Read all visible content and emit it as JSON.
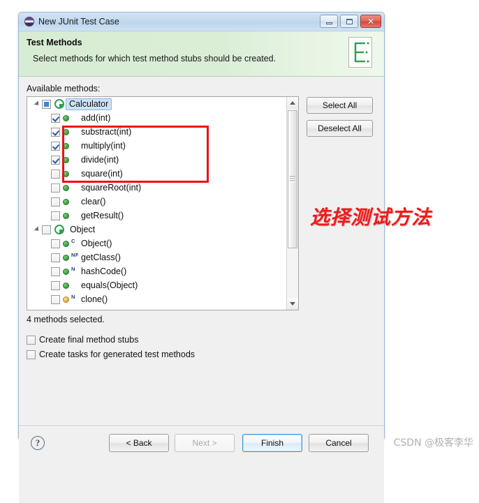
{
  "window": {
    "title": "New JUnit Test Case",
    "icon": "junit-icon",
    "controls": {
      "minimize": "minimize-icon",
      "maximize": "maximize-icon",
      "close": "close-icon"
    }
  },
  "header": {
    "title": "Test Methods",
    "subtitle": "Select methods for which test method stubs should be created.",
    "icon": "junit-banner-icon"
  },
  "main": {
    "available_label": "Available methods:",
    "status": "4 methods selected.",
    "tree": [
      {
        "label": "Calculator",
        "type": "class",
        "level": 0,
        "checkbox": "partial",
        "selected": true,
        "expanded": true,
        "badge": "",
        "dot": ""
      },
      {
        "label": "add(int)",
        "type": "method",
        "level": 1,
        "checkbox": "checked",
        "selected": false,
        "badge": "",
        "dot": "green"
      },
      {
        "label": "substract(int)",
        "type": "method",
        "level": 1,
        "checkbox": "checked",
        "selected": false,
        "badge": "",
        "dot": "green"
      },
      {
        "label": "multiply(int)",
        "type": "method",
        "level": 1,
        "checkbox": "checked",
        "selected": false,
        "badge": "",
        "dot": "green"
      },
      {
        "label": "divide(int)",
        "type": "method",
        "level": 1,
        "checkbox": "checked",
        "selected": false,
        "badge": "",
        "dot": "green"
      },
      {
        "label": "square(int)",
        "type": "method",
        "level": 1,
        "checkbox": "unchecked",
        "selected": false,
        "badge": "",
        "dot": "green"
      },
      {
        "label": "squareRoot(int)",
        "type": "method",
        "level": 1,
        "checkbox": "unchecked",
        "selected": false,
        "badge": "",
        "dot": "green"
      },
      {
        "label": "clear()",
        "type": "method",
        "level": 1,
        "checkbox": "unchecked",
        "selected": false,
        "badge": "",
        "dot": "green"
      },
      {
        "label": "getResult()",
        "type": "method",
        "level": 1,
        "checkbox": "unchecked",
        "selected": false,
        "badge": "",
        "dot": "green"
      },
      {
        "label": "Object",
        "type": "class",
        "level": 0,
        "checkbox": "unchecked",
        "selected": false,
        "expanded": true,
        "badge": "",
        "dot": ""
      },
      {
        "label": "Object()",
        "type": "method",
        "level": 1,
        "checkbox": "unchecked",
        "selected": false,
        "badge": "C",
        "dot": "green"
      },
      {
        "label": "getClass()",
        "type": "method",
        "level": 1,
        "checkbox": "unchecked",
        "selected": false,
        "badge": "NF",
        "dot": "green"
      },
      {
        "label": "hashCode()",
        "type": "method",
        "level": 1,
        "checkbox": "unchecked",
        "selected": false,
        "badge": "N",
        "dot": "green"
      },
      {
        "label": "equals(Object)",
        "type": "method",
        "level": 1,
        "checkbox": "unchecked",
        "selected": false,
        "badge": "",
        "dot": "green"
      },
      {
        "label": "clone()",
        "type": "method",
        "level": 1,
        "checkbox": "unchecked",
        "selected": false,
        "badge": "N",
        "dot": "yellow"
      }
    ],
    "side_buttons": {
      "select_all": "Select All",
      "deselect_all": "Deselect All"
    },
    "options": [
      {
        "label": "Create final method stubs",
        "checked": false
      },
      {
        "label": "Create tasks for generated test methods",
        "checked": false
      }
    ]
  },
  "footer": {
    "help": "?",
    "back": "< Back",
    "next": "Next >",
    "finish": "Finish",
    "cancel": "Cancel",
    "next_enabled": false,
    "finish_focused": true
  },
  "annotations": {
    "chinese_note": "选择测试方法",
    "watermark": "CSDN @极客李华",
    "highlight_color": "#ee1111",
    "note_color": "#ee1b1b"
  }
}
